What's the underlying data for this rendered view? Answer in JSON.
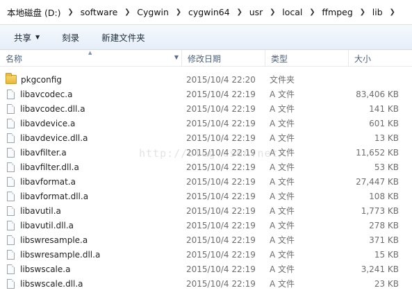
{
  "breadcrumb": {
    "items": [
      {
        "label": "本地磁盘 (D:)"
      },
      {
        "label": "software"
      },
      {
        "label": "Cygwin"
      },
      {
        "label": "cygwin64"
      },
      {
        "label": "usr"
      },
      {
        "label": "local"
      },
      {
        "label": "ffmpeg"
      },
      {
        "label": "lib"
      }
    ],
    "separator": "❯"
  },
  "toolbar": {
    "share_label": "共享",
    "burn_label": "刻录",
    "new_folder_label": "新建文件夹"
  },
  "columns": {
    "name": "名称",
    "date": "修改日期",
    "type": "类型",
    "size": "大小"
  },
  "files": [
    {
      "name": "pkgconfig",
      "date": "2015/10/4 22:20",
      "type": "文件夹",
      "size": "",
      "icon": "folder-icon"
    },
    {
      "name": "libavcodec.a",
      "date": "2015/10/4 22:19",
      "type": "A 文件",
      "size": "83,406 KB",
      "icon": "file-icon"
    },
    {
      "name": "libavcodec.dll.a",
      "date": "2015/10/4 22:19",
      "type": "A 文件",
      "size": "141 KB",
      "icon": "file-icon"
    },
    {
      "name": "libavdevice.a",
      "date": "2015/10/4 22:19",
      "type": "A 文件",
      "size": "601 KB",
      "icon": "file-icon"
    },
    {
      "name": "libavdevice.dll.a",
      "date": "2015/10/4 22:19",
      "type": "A 文件",
      "size": "13 KB",
      "icon": "file-icon"
    },
    {
      "name": "libavfilter.a",
      "date": "2015/10/4 22:19",
      "type": "A 文件",
      "size": "11,652 KB",
      "icon": "file-icon"
    },
    {
      "name": "libavfilter.dll.a",
      "date": "2015/10/4 22:19",
      "type": "A 文件",
      "size": "53 KB",
      "icon": "file-icon"
    },
    {
      "name": "libavformat.a",
      "date": "2015/10/4 22:19",
      "type": "A 文件",
      "size": "27,447 KB",
      "icon": "file-icon"
    },
    {
      "name": "libavformat.dll.a",
      "date": "2015/10/4 22:19",
      "type": "A 文件",
      "size": "108 KB",
      "icon": "file-icon"
    },
    {
      "name": "libavutil.a",
      "date": "2015/10/4 22:19",
      "type": "A 文件",
      "size": "1,773 KB",
      "icon": "file-icon"
    },
    {
      "name": "libavutil.dll.a",
      "date": "2015/10/4 22:19",
      "type": "A 文件",
      "size": "278 KB",
      "icon": "file-icon"
    },
    {
      "name": "libswresample.a",
      "date": "2015/10/4 22:19",
      "type": "A 文件",
      "size": "371 KB",
      "icon": "file-icon"
    },
    {
      "name": "libswresample.dll.a",
      "date": "2015/10/4 22:19",
      "type": "A 文件",
      "size": "15 KB",
      "icon": "file-icon"
    },
    {
      "name": "libswscale.a",
      "date": "2015/10/4 22:19",
      "type": "A 文件",
      "size": "3,241 KB",
      "icon": "file-icon"
    },
    {
      "name": "libswscale.dll.a",
      "date": "2015/10/4 22:19",
      "type": "A 文件",
      "size": "23 KB",
      "icon": "file-icon"
    }
  ],
  "watermark": "http://blog.csdn.net/"
}
